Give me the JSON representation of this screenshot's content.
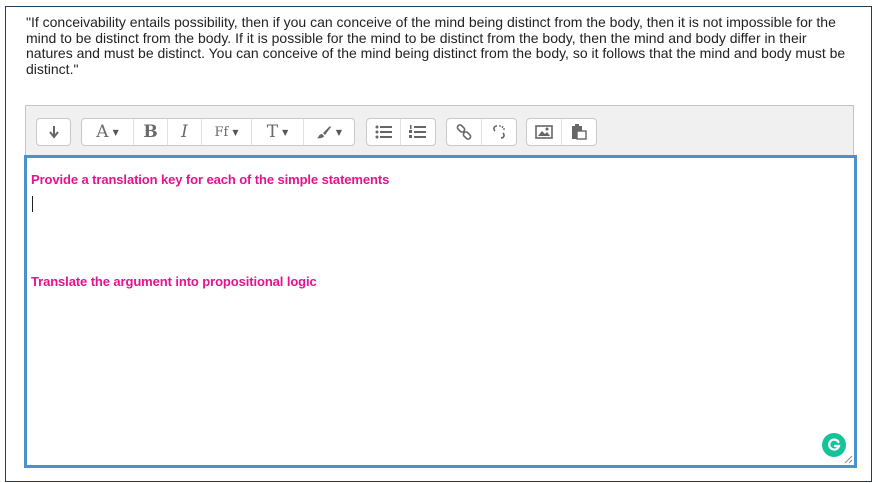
{
  "question": {
    "text": "\"If conceivability entails possibility, then if you can conceive of the mind being distinct from the body, then it is not impossible for the mind to be distinct from the body. If it is possible for the mind to be distinct from the body, then the mind and body differ in their natures and must be distinct. You can conceive of the mind being distinct from the body, so it follows that the mind and body must be distinct.\""
  },
  "toolbar": {
    "font_color_glyph": "A",
    "bold_glyph": "B",
    "italic_glyph": "I",
    "font_family_glyph": "Ff",
    "font_size_glyph": "T",
    "icons": [
      "toggle-toolbar-icon",
      "font-color-icon",
      "bold-icon",
      "italic-icon",
      "font-family-icon",
      "font-size-icon",
      "paint-brush-icon",
      "bullet-list-icon",
      "numbered-list-icon",
      "link-icon",
      "unlink-icon",
      "image-icon",
      "paste-icon"
    ]
  },
  "editor": {
    "line1": "Provide a translation key for each of the simple statements",
    "line2": "Translate the argument into propositional logic"
  },
  "colors": {
    "accent_pink": "#e6128f",
    "editor_border": "#4d8fcf",
    "grammarly": "#15c39a"
  }
}
